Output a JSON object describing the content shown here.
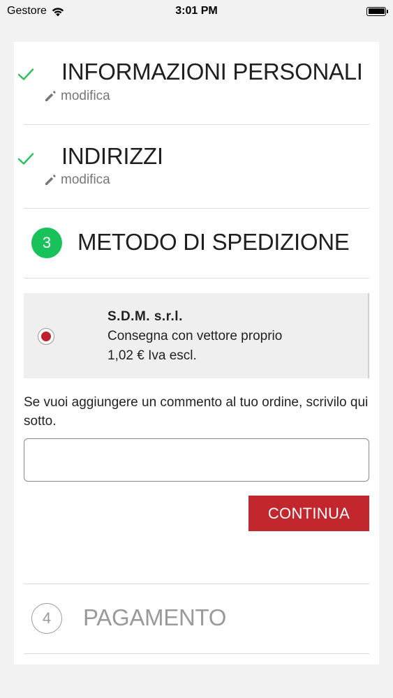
{
  "statusbar": {
    "carrier": "Gestore",
    "time": "3:01 PM"
  },
  "steps": {
    "personal_info": {
      "title": "INFORMAZIONI PERSONALI",
      "edit_label": "modifica"
    },
    "addresses": {
      "title": "INDIRIZZI",
      "edit_label": "modifica"
    },
    "shipping": {
      "number": "3",
      "title": "METODO DI SPEDIZIONE"
    },
    "payment": {
      "number": "4",
      "title": "PAGAMENTO"
    }
  },
  "shipping_option": {
    "name": "S.D.M. s.r.l.",
    "description": "Consegna con vettore proprio",
    "price": "1,02 € Iva escl."
  },
  "comment": {
    "label": "Se vuoi aggiungere un commento al tuo ordine, scrivilo qui sotto.",
    "value": "",
    "placeholder": ""
  },
  "continue_label": "CONTINUA",
  "colors": {
    "accent_red": "#c1272d",
    "success_green": "#19c15a"
  }
}
